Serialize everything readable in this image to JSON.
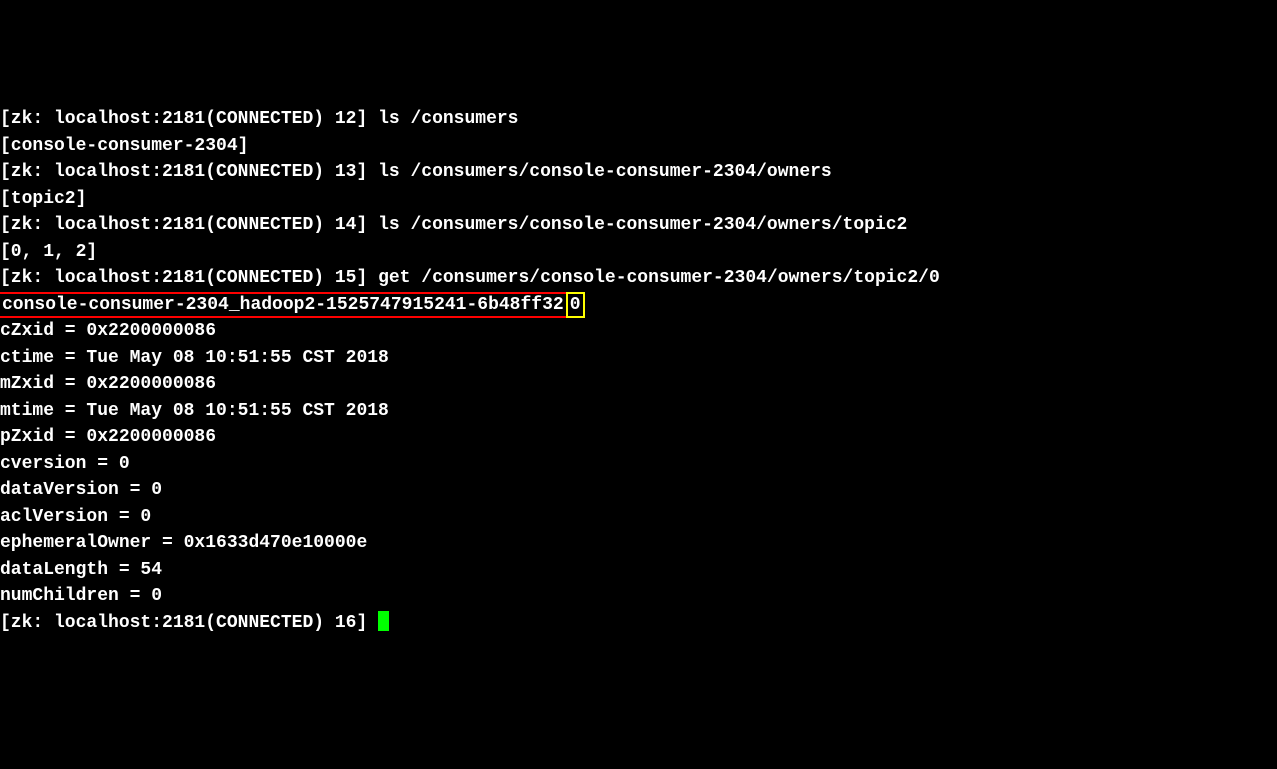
{
  "lines": {
    "l1_prompt": "[zk: localhost:2181(CONNECTED) 12] ",
    "l1_cmd": "ls /consumers",
    "l2": "[console-consumer-2304]",
    "l3_prompt": "[zk: localhost:2181(CONNECTED) 13] ",
    "l3_cmd": "ls /consumers/console-consumer-2304/owners",
    "l4": "[topic2]",
    "l5_prompt": "[zk: localhost:2181(CONNECTED) 14] ",
    "l5_cmd": "ls /consumers/console-consumer-2304/owners/topic2",
    "l6": "[0, 1, 2]",
    "l7_prompt": "[zk: localhost:2181(CONNECTED) 15] ",
    "l7_cmd": "get /consumers/console-consumer-2304/owners/topic2/0",
    "l8_red": "console-consumer-2304_hadoop2-1525747915241-6b48ff32",
    "l8_dash": "-",
    "l8_yellow": "0",
    "l9": "cZxid = 0x2200000086",
    "l10": "ctime = Tue May 08 10:51:55 CST 2018",
    "l11": "mZxid = 0x2200000086",
    "l12": "mtime = Tue May 08 10:51:55 CST 2018",
    "l13": "pZxid = 0x2200000086",
    "l14": "cversion = 0",
    "l15": "dataVersion = 0",
    "l16": "aclVersion = 0",
    "l17": "ephemeralOwner = 0x1633d470e10000e",
    "l18": "dataLength = 54",
    "l19": "numChildren = 0",
    "l20_prompt": "[zk: localhost:2181(CONNECTED) 16] "
  }
}
